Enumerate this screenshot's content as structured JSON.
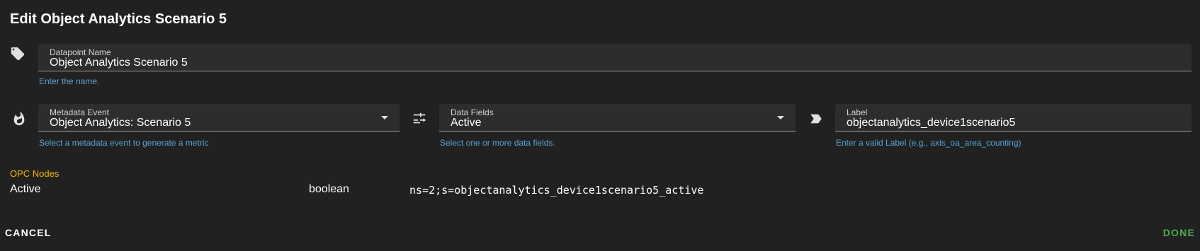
{
  "dialog": {
    "title": "Edit Object Analytics Scenario 5"
  },
  "datapoint_name": {
    "label": "Datapoint Name",
    "value": "Object Analytics Scenario 5",
    "hint": "Enter the name.",
    "icon": "tag-icon"
  },
  "metadata_event": {
    "label": "Metadata Event",
    "value": "Object Analytics: Scenario 5",
    "hint": "Select a metadata event to generate a metric",
    "icon": "fire-icon"
  },
  "data_fields": {
    "label": "Data Fields",
    "value": "Active",
    "hint": "Select one or more data fields.",
    "icon": "data-fields-icon"
  },
  "label_field": {
    "label": "Label",
    "value": "objectanalytics_device1scenario5",
    "hint": "Enter a valid Label (e.g., axis_oa_area_counting)",
    "icon": "label-icon"
  },
  "opc_nodes": {
    "title": "OPC Nodes",
    "rows": [
      {
        "name": "Active",
        "type": "boolean",
        "node_id": "ns=2;s=objectanalytics_device1scenario5_active"
      }
    ]
  },
  "actions": {
    "cancel": "CANCEL",
    "done": "DONE"
  },
  "colors": {
    "background": "#212121",
    "field": "#2d2d2d",
    "hint": "#5ba3d6",
    "section": "#f5b400",
    "done": "#4caf50"
  }
}
